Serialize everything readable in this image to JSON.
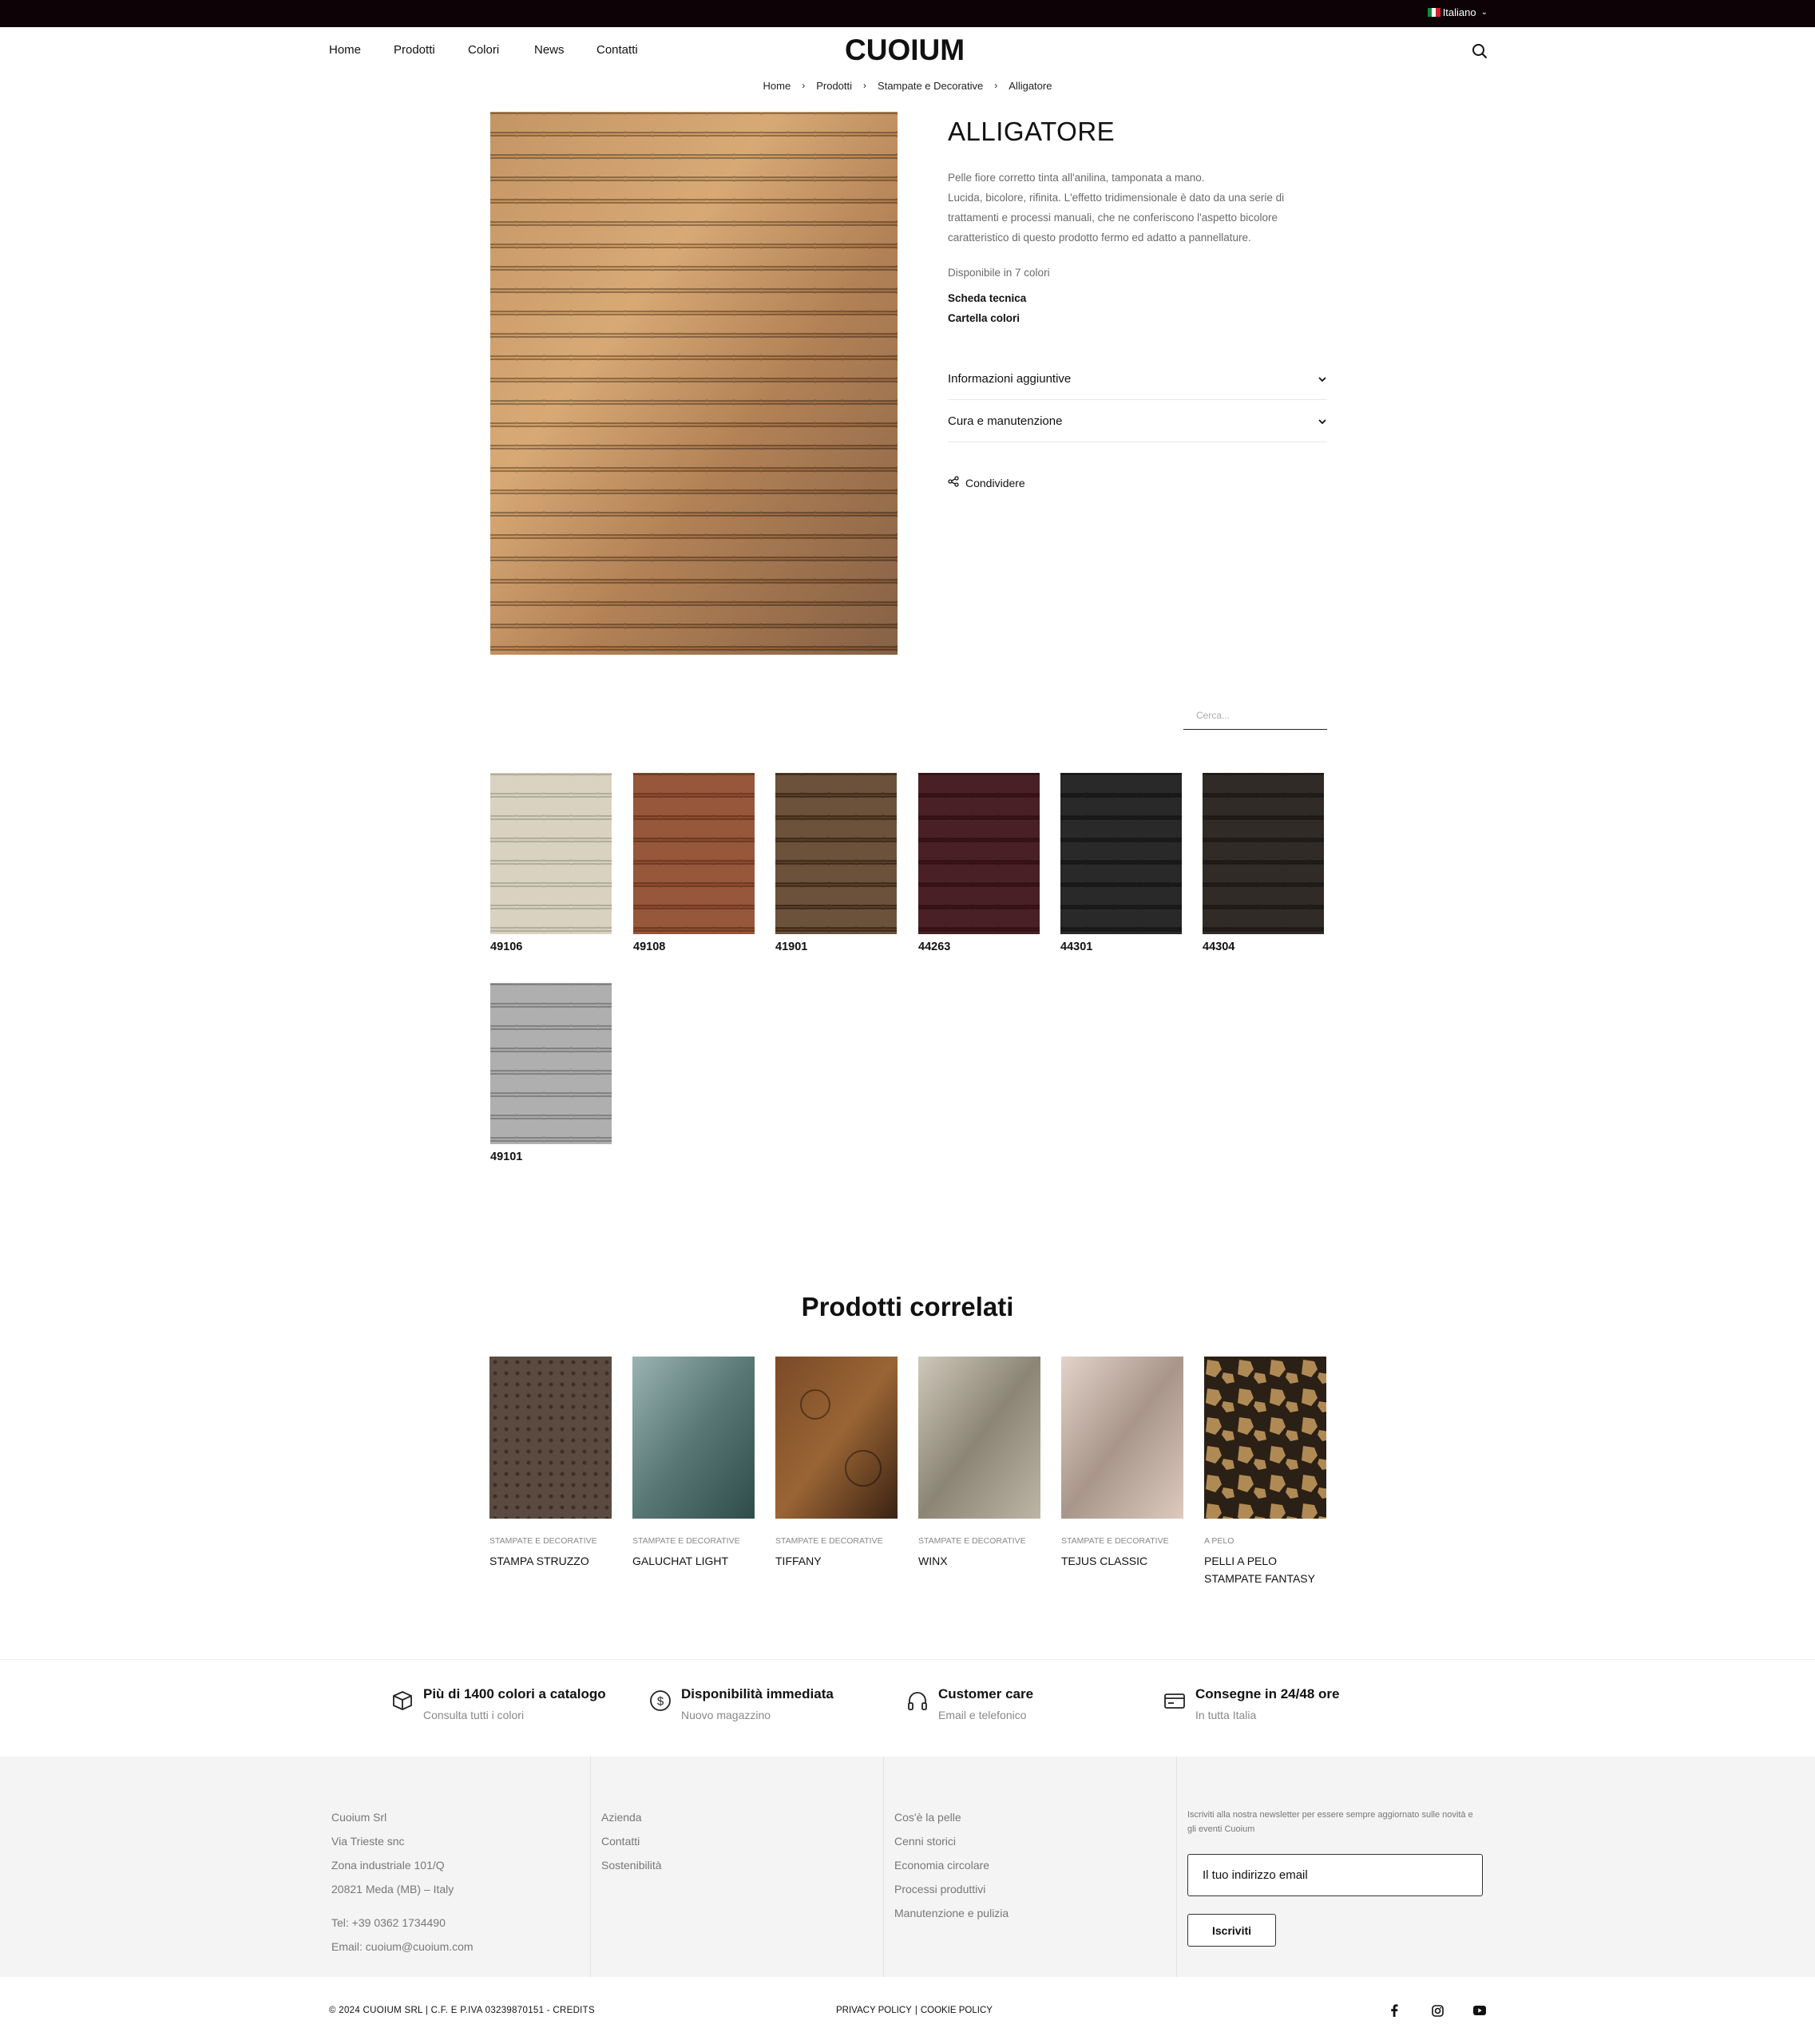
{
  "topbar": {
    "language": "Italiano"
  },
  "header": {
    "nav": [
      "Home",
      "Prodotti",
      "Colori",
      "News",
      "Contatti"
    ],
    "logo": "CUOIUM"
  },
  "breadcrumb": [
    "Home",
    "Prodotti",
    "Stampate e Decorative",
    "Alligatore"
  ],
  "product": {
    "title": "ALLIGATORE",
    "description": [
      "Pelle fiore corretto tinta all'anilina, tamponata a mano.",
      "Lucida, bicolore, rifinita. L'effetto tridimensionale è dato da una serie di",
      "trattamenti e processi manuali, che ne conferiscono l'aspetto bicolore",
      "caratteristico di questo prodotto fermo ed adatto a pannellature."
    ],
    "availability": "Disponibile in 7 colori",
    "links": [
      "Scheda tecnica",
      "Cartella colori"
    ],
    "accordions": [
      "Informazioni aggiuntive",
      "Cura e manutenzione"
    ],
    "share": "Condividere"
  },
  "colors_search": {
    "placeholder": "Cerca..."
  },
  "swatches": [
    {
      "code": "49106",
      "color": "#d7d0bd"
    },
    {
      "code": "49108",
      "color": "#8e4a2c"
    },
    {
      "code": "41901",
      "color": "#5b3d25"
    },
    {
      "code": "44263",
      "color": "#3d1217"
    },
    {
      "code": "44301",
      "color": "#1b1b1b"
    },
    {
      "code": "44304",
      "color": "#231d19"
    },
    {
      "code": "49101",
      "color": "#a9a9a9"
    }
  ],
  "related": {
    "title": "Prodotti correlati",
    "items": [
      {
        "category": "STAMPATE E DECORATIVE",
        "name": "STAMPA STRUZZO",
        "color": "#5a4a3f"
      },
      {
        "category": "STAMPATE E DECORATIVE",
        "name": "GALUCHAT LIGHT",
        "color": "#6f8b8c"
      },
      {
        "category": "STAMPATE E DECORATIVE",
        "name": "TIFFANY",
        "color": "#5e3a22"
      },
      {
        "category": "STAMPATE E DECORATIVE",
        "name": "WINX",
        "color": "#a9a296"
      },
      {
        "category": "STAMPATE E DECORATIVE",
        "name": "TEJUS CLASSIC",
        "color": "#c9b8ad"
      },
      {
        "category": "A PELO",
        "name_lines": [
          "PELLI A PELO",
          "STAMPATE FANTASY"
        ],
        "color": "#3c2d1e"
      }
    ]
  },
  "features": [
    {
      "icon": "box-icon",
      "title": "Più di 1400 colori a catalogo",
      "subtitle": "Consulta tutti i colori"
    },
    {
      "icon": "dollar-icon",
      "title": "Disponibilità immediata",
      "subtitle": "Nuovo magazzino"
    },
    {
      "icon": "headphones-icon",
      "title": "Customer care",
      "subtitle": "Email e telefonico"
    },
    {
      "icon": "credit-card-icon",
      "title": "Consegne in 24/48 ore",
      "subtitle": "In tutta Italia"
    }
  ],
  "footer": {
    "address": [
      "Cuoium Srl",
      "Via Trieste snc",
      "Zona industriale 101/Q",
      "20821 Meda (MB) – Italy"
    ],
    "contacts": [
      "Tel: +39 0362 1734490",
      "Email: cuoium@cuoium.com"
    ],
    "col2": [
      "Azienda",
      "Contatti",
      "Sostenibilità"
    ],
    "col3": [
      "Cos'è la pelle",
      "Cenni storici",
      "Economia circolare",
      "Processi produttivi",
      "Manutenzione e pulizia"
    ],
    "newsletter_text": "Iscriviti alla nostra newsletter per essere sempre aggiornato sulle novità e gli eventi Cuoium",
    "newsletter_placeholder": "Il tuo indirizzo email",
    "newsletter_button": "Iscriviti"
  },
  "bottom": {
    "copyright": "© 2024 CUOIUM SRL | C.F. E P.IVA 03239870151 - CREDITS",
    "privacy": "PRIVACY POLICY",
    "divider": "|",
    "cookie": "COOKIE POLICY",
    "social": [
      "facebook-icon",
      "instagram-icon",
      "youtube-icon"
    ]
  }
}
